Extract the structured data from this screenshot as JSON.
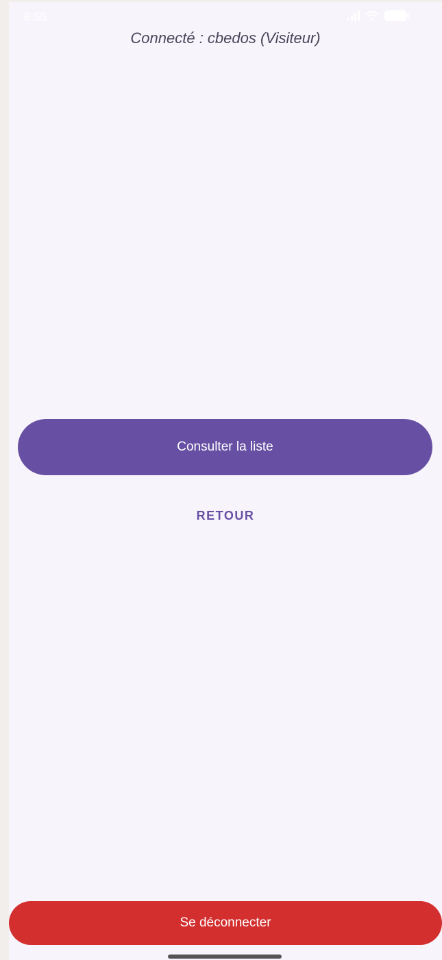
{
  "status_bar": {
    "time": "8:55",
    "icons": [
      "signal-icon",
      "wifi-icon",
      "battery-icon"
    ]
  },
  "header": {
    "connected_text": "Connecté : cbedos (Visiteur)"
  },
  "main": {
    "consult_button_label": "Consulter la liste",
    "back_button_label": "RETOUR"
  },
  "footer": {
    "logout_button_label": "Se déconnecter"
  },
  "colors": {
    "background": "#f8f4fb",
    "primary": "#6750a4",
    "danger": "#d32f2f",
    "text_secondary": "#4a4459"
  }
}
